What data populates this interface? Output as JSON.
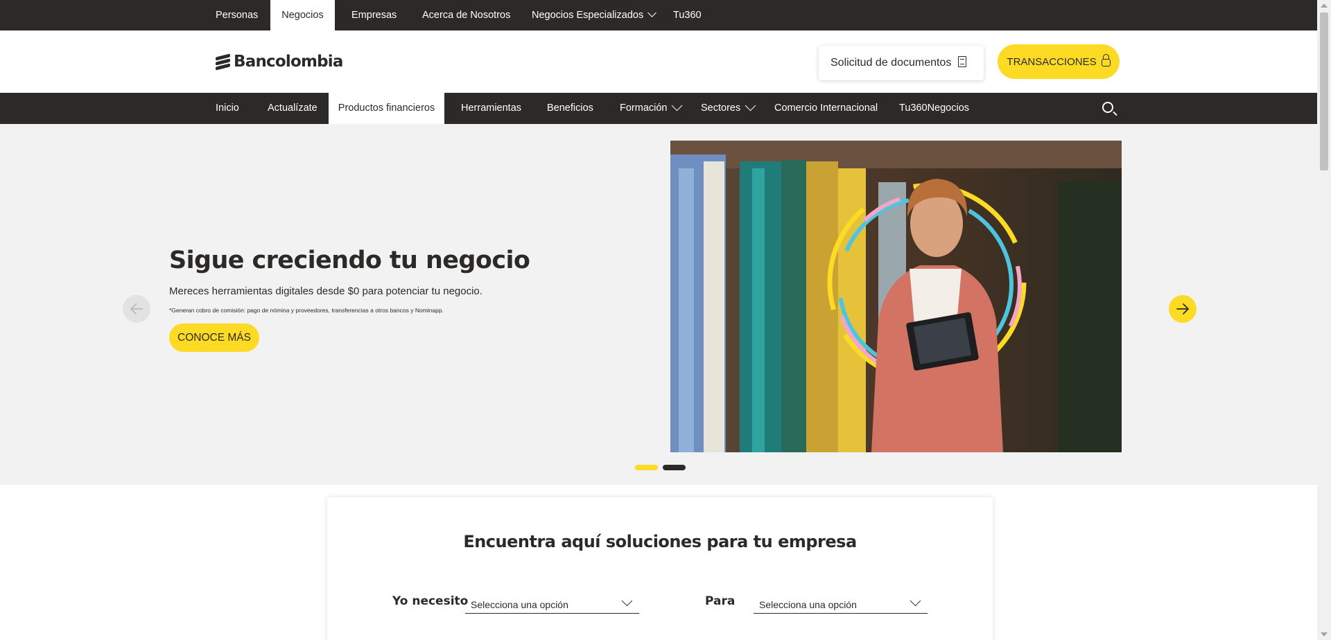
{
  "top_nav": {
    "items": [
      {
        "label": "Personas"
      },
      {
        "label": "Negocios",
        "active": true
      },
      {
        "label": "Empresas"
      },
      {
        "label": "Acerca de Nosotros"
      },
      {
        "label": "Negocios Especializados",
        "has_dropdown": true
      },
      {
        "label": "Tu360"
      }
    ]
  },
  "header": {
    "logo_text": "Bancolombia",
    "docs_button": "Solicitud de documentos",
    "transactions_button": "TRANSACCIONES"
  },
  "main_nav": {
    "items": [
      {
        "label": "Inicio"
      },
      {
        "label": "Actualízate"
      },
      {
        "label": "Productos financieros",
        "active": true
      },
      {
        "label": "Herramientas"
      },
      {
        "label": "Beneficios"
      },
      {
        "label": "Formación",
        "has_dropdown": true
      },
      {
        "label": "Sectores",
        "has_dropdown": true
      },
      {
        "label": "Comercio Internacional"
      },
      {
        "label": "Tu360Negocios"
      }
    ],
    "search_icon": "search-icon"
  },
  "hero": {
    "title": "Sigue creciendo tu negocio",
    "subtitle": "Mereces herramientas digitales desde $0 para potenciar tu negocio.",
    "note": "*Generan cobro de comisión: pago de nómina y proveedores, transferencias a otros bancos y Nominapp.",
    "cta": "CONOCE MÁS",
    "slides_count": 2,
    "active_slide": 1
  },
  "solutions": {
    "title": "Encuentra aquí soluciones para tu empresa",
    "need_label": "Yo necesito",
    "need_placeholder": "Selecciona una opción",
    "for_label": "Para",
    "for_placeholder": "Selecciona una opción"
  },
  "colors": {
    "brand_yellow": "#fdda24",
    "dark": "#2c2a29",
    "hero_bg": "#f2f2f2"
  }
}
